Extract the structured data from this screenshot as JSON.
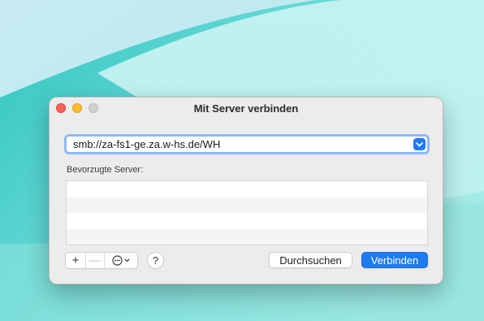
{
  "window": {
    "title": "Mit Server verbinden"
  },
  "address": {
    "value": "smb://za-fs1-ge.za.w-hs.de/WH"
  },
  "favorites": {
    "label": "Bevorzugte Server:",
    "rows": [
      "",
      "",
      "",
      ""
    ]
  },
  "toolbar": {
    "add_label": "+",
    "remove_label": "—",
    "help_label": "?"
  },
  "buttons": {
    "browse_label": "Durchsuchen",
    "connect_label": "Verbinden"
  },
  "colors": {
    "accent": "#1e7bf2",
    "close": "#fe5f57",
    "minimize": "#febc2e",
    "zoom_inactive": "#d0d0d0"
  }
}
